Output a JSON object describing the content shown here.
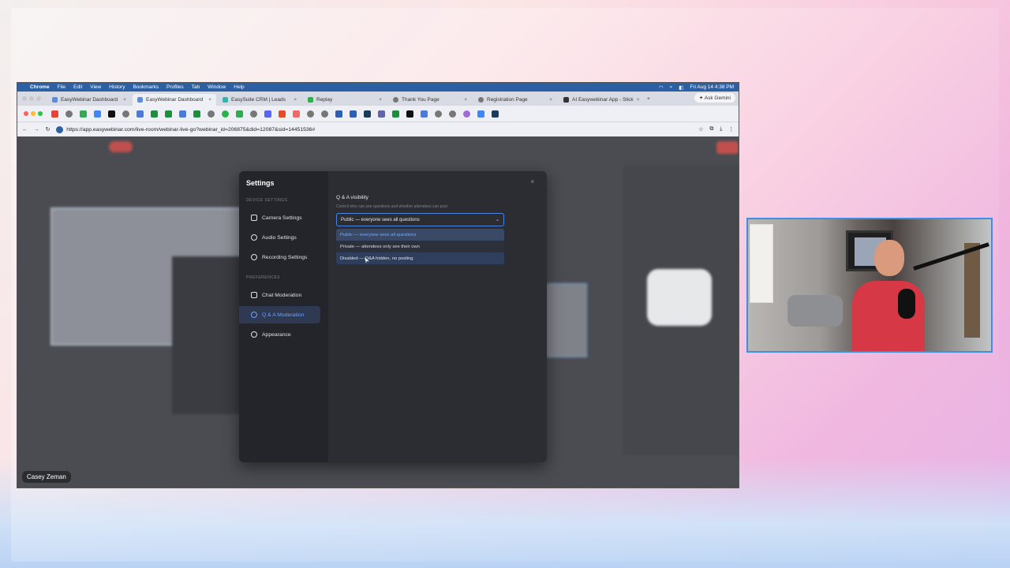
{
  "menubar": {
    "app": "Chrome",
    "menus": [
      "File",
      "Edit",
      "View",
      "History",
      "Bookmarks",
      "Profiles",
      "Tab",
      "Window",
      "Help"
    ],
    "clock": "Fri Aug 14  4:38 PM"
  },
  "tabs": [
    {
      "label": "EasyWebinar Dashboard",
      "active": false
    },
    {
      "label": "EasyWebinar Dashboard",
      "active": true
    },
    {
      "label": "EasySuite CRM | Leads",
      "active": false
    },
    {
      "label": "Replay",
      "active": false
    },
    {
      "label": "Thank You Page",
      "active": false
    },
    {
      "label": "Registration Page",
      "active": false
    },
    {
      "label": "AI Easywebinar App - Slick",
      "active": false
    }
  ],
  "new_tab": "+",
  "ask_gemini": "Ask Gemini",
  "url": "https://app.easywebinar.com/live-room/webinar-live-go?webinar_id=206875&did=12087&sid=14451536#",
  "settings": {
    "title": "Settings",
    "close": "×",
    "device_section": "DEVICE SETTINGS",
    "preferences_section": "PREFERENCES",
    "nav": [
      {
        "label": "Camera Settings",
        "icon": "camera-icon",
        "active": false
      },
      {
        "label": "Audio Settings",
        "icon": "microphone-icon",
        "active": false
      },
      {
        "label": "Recording Settings",
        "icon": "record-icon",
        "active": false
      },
      {
        "label": "Chat Moderation",
        "icon": "chat-icon",
        "active": false
      },
      {
        "label": "Q & A Moderation",
        "icon": "question-icon",
        "active": true
      },
      {
        "label": "Appearance",
        "icon": "moon-icon",
        "active": false
      }
    ],
    "qa_visibility": {
      "label": "Q & A visibility",
      "help": "Control who can see questions and whether attendees can post",
      "selected": "Public — everyone sees all questions",
      "options": [
        "Public — everyone sees all questions",
        "Private — attendees only see their own",
        "Disabled — Q&A hidden, no posting"
      ]
    }
  },
  "presenter_name": "Casey Zeman",
  "colors": {
    "accent": "#4a83e0",
    "macbar": "#2d5fa3",
    "modal_bg": "#2b2d33",
    "sidebar_bg": "#23252b"
  }
}
